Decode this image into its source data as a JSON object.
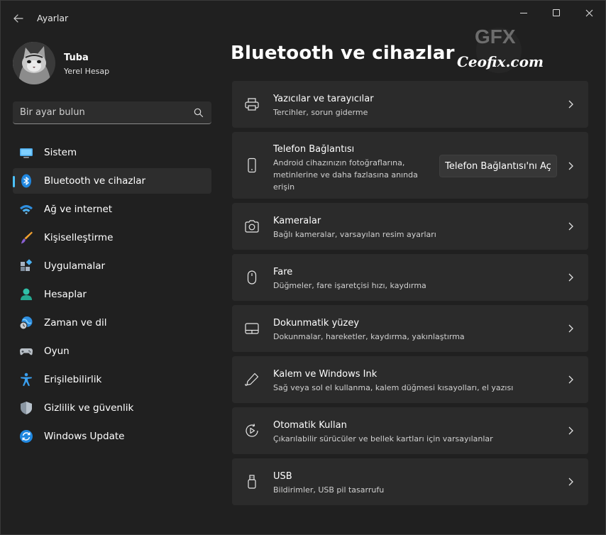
{
  "window": {
    "title": "Ayarlar"
  },
  "profile": {
    "name": "Tuba",
    "account_type": "Yerel Hesap"
  },
  "search": {
    "placeholder": "Bir ayar bulun"
  },
  "nav": {
    "items": [
      {
        "label": "Sistem",
        "icon": "monitor-icon"
      },
      {
        "label": "Bluetooth ve cihazlar",
        "icon": "bluetooth-icon",
        "active": true
      },
      {
        "label": "Ağ ve internet",
        "icon": "wifi-icon"
      },
      {
        "label": "Kişiselleştirme",
        "icon": "paintbrush-icon"
      },
      {
        "label": "Uygulamalar",
        "icon": "apps-icon"
      },
      {
        "label": "Hesaplar",
        "icon": "person-icon"
      },
      {
        "label": "Zaman ve dil",
        "icon": "globe-clock-icon"
      },
      {
        "label": "Oyun",
        "icon": "gamepad-icon"
      },
      {
        "label": "Erişilebilirlik",
        "icon": "accessibility-icon"
      },
      {
        "label": "Gizlilik ve güvenlik",
        "icon": "shield-icon"
      },
      {
        "label": "Windows Update",
        "icon": "update-icon"
      }
    ]
  },
  "main": {
    "title": "Bluetooth ve cihazlar",
    "watermark": {
      "logo_text": "GFX",
      "site": "Ceofix.com"
    },
    "cards": [
      {
        "title": "Yazıcılar ve tarayıcılar",
        "desc": "Tercihler, sorun giderme",
        "icon": "printer-icon"
      },
      {
        "title": "Telefon Bağlantısı",
        "desc": "Android cihazınızın fotoğraflarına, metinlerine ve daha fazlasına anında erişin",
        "icon": "phone-icon",
        "button": "Telefon Bağlantısı'nı Aç"
      },
      {
        "title": "Kameralar",
        "desc": "Bağlı kameralar, varsayılan resim ayarları",
        "icon": "camera-icon"
      },
      {
        "title": "Fare",
        "desc": "Düğmeler, fare işaretçisi hızı, kaydırma",
        "icon": "mouse-icon"
      },
      {
        "title": "Dokunmatik yüzey",
        "desc": "Dokunmalar, hareketler, kaydırma, yakınlaştırma",
        "icon": "touchpad-icon"
      },
      {
        "title": "Kalem ve Windows Ink",
        "desc": "Sağ veya sol el kullanma, kalem düğmesi kısayolları, el yazısı",
        "icon": "pen-icon"
      },
      {
        "title": "Otomatik Kullan",
        "desc": "Çıkarılabilir sürücüler ve bellek kartları için varsayılanlar",
        "icon": "autoplay-icon"
      },
      {
        "title": "USB",
        "desc": "Bildirimler, USB pil tasarrufu",
        "icon": "usb-icon"
      }
    ]
  },
  "colors": {
    "accent": "#4cc2ff",
    "background": "#202020",
    "card": "#2b2b2b"
  }
}
